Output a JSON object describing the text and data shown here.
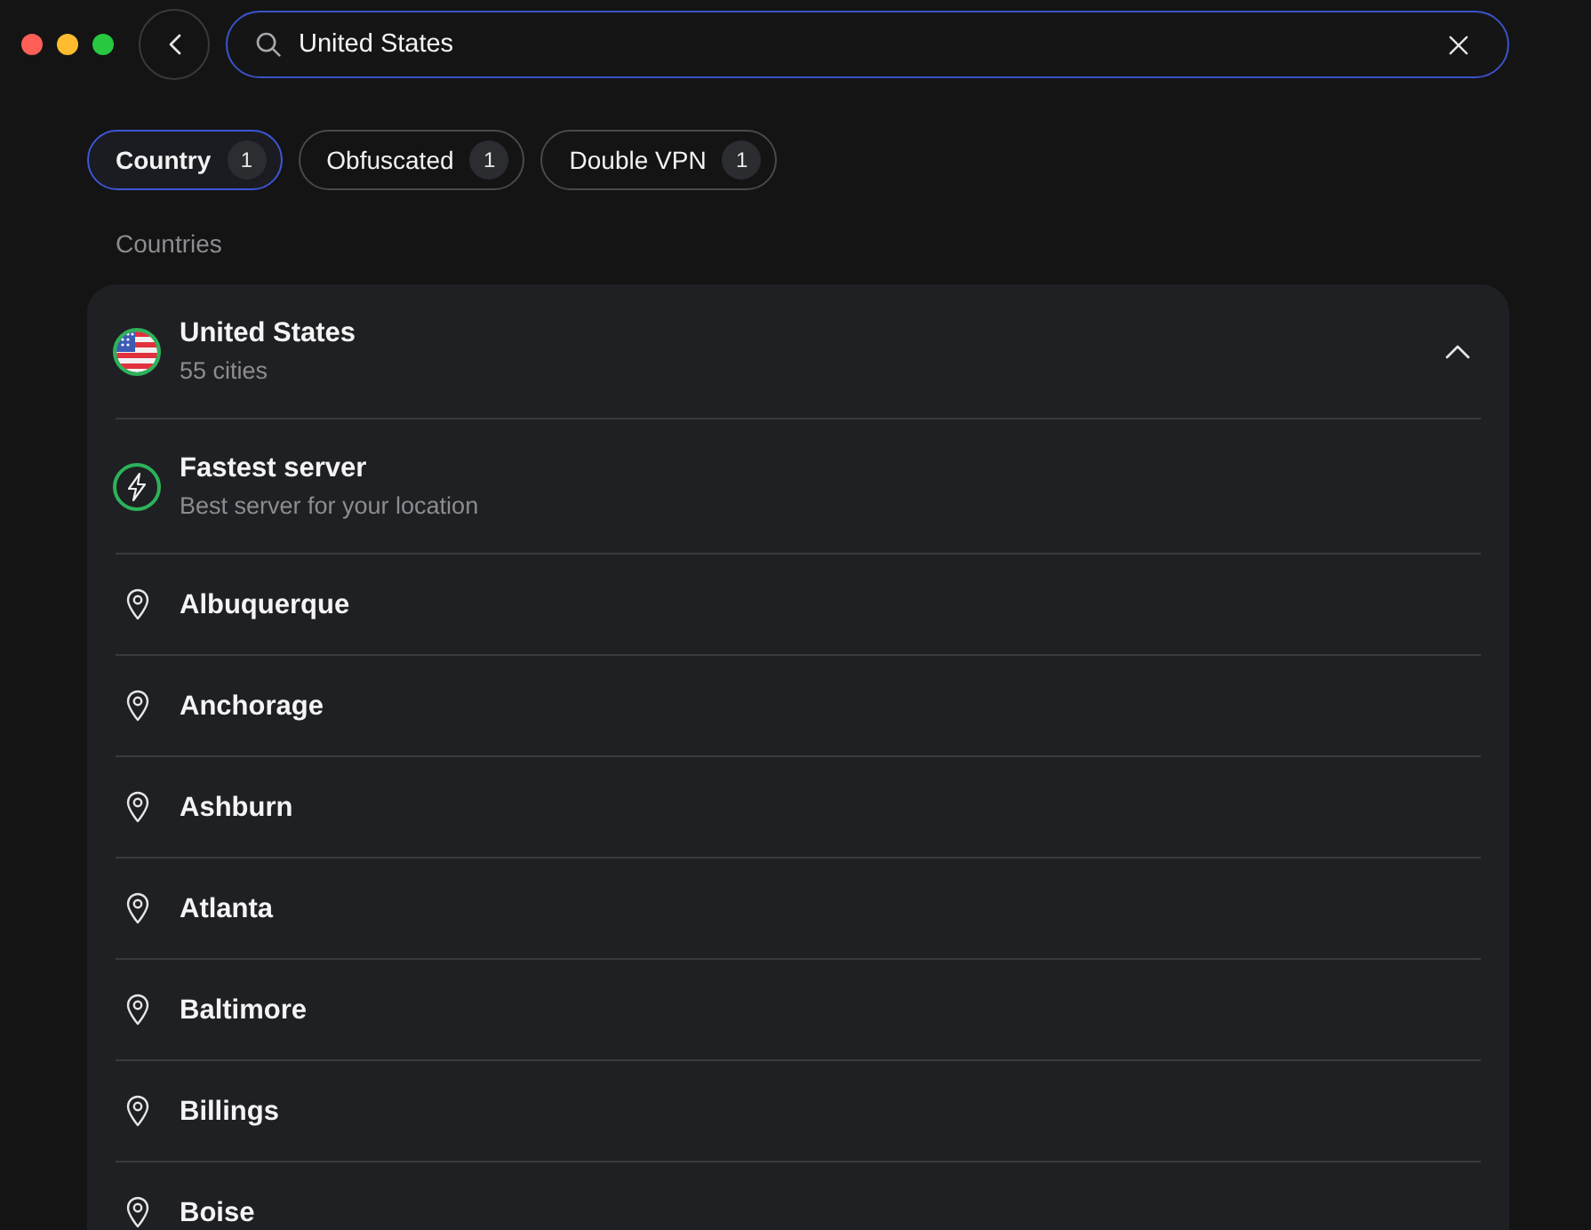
{
  "search": {
    "value": "United States"
  },
  "filters": [
    {
      "label": "Country",
      "count": "1",
      "selected": true
    },
    {
      "label": "Obfuscated",
      "count": "1",
      "selected": false
    },
    {
      "label": "Double VPN",
      "count": "1",
      "selected": false
    }
  ],
  "section_title": "Countries",
  "country": {
    "name": "United States",
    "subtitle": "55 cities",
    "expanded": true,
    "fastest": {
      "title": "Fastest server",
      "subtitle": "Best server for your location"
    },
    "cities": [
      "Albuquerque",
      "Anchorage",
      "Ashburn",
      "Atlanta",
      "Baltimore",
      "Billings",
      "Boise"
    ]
  }
}
